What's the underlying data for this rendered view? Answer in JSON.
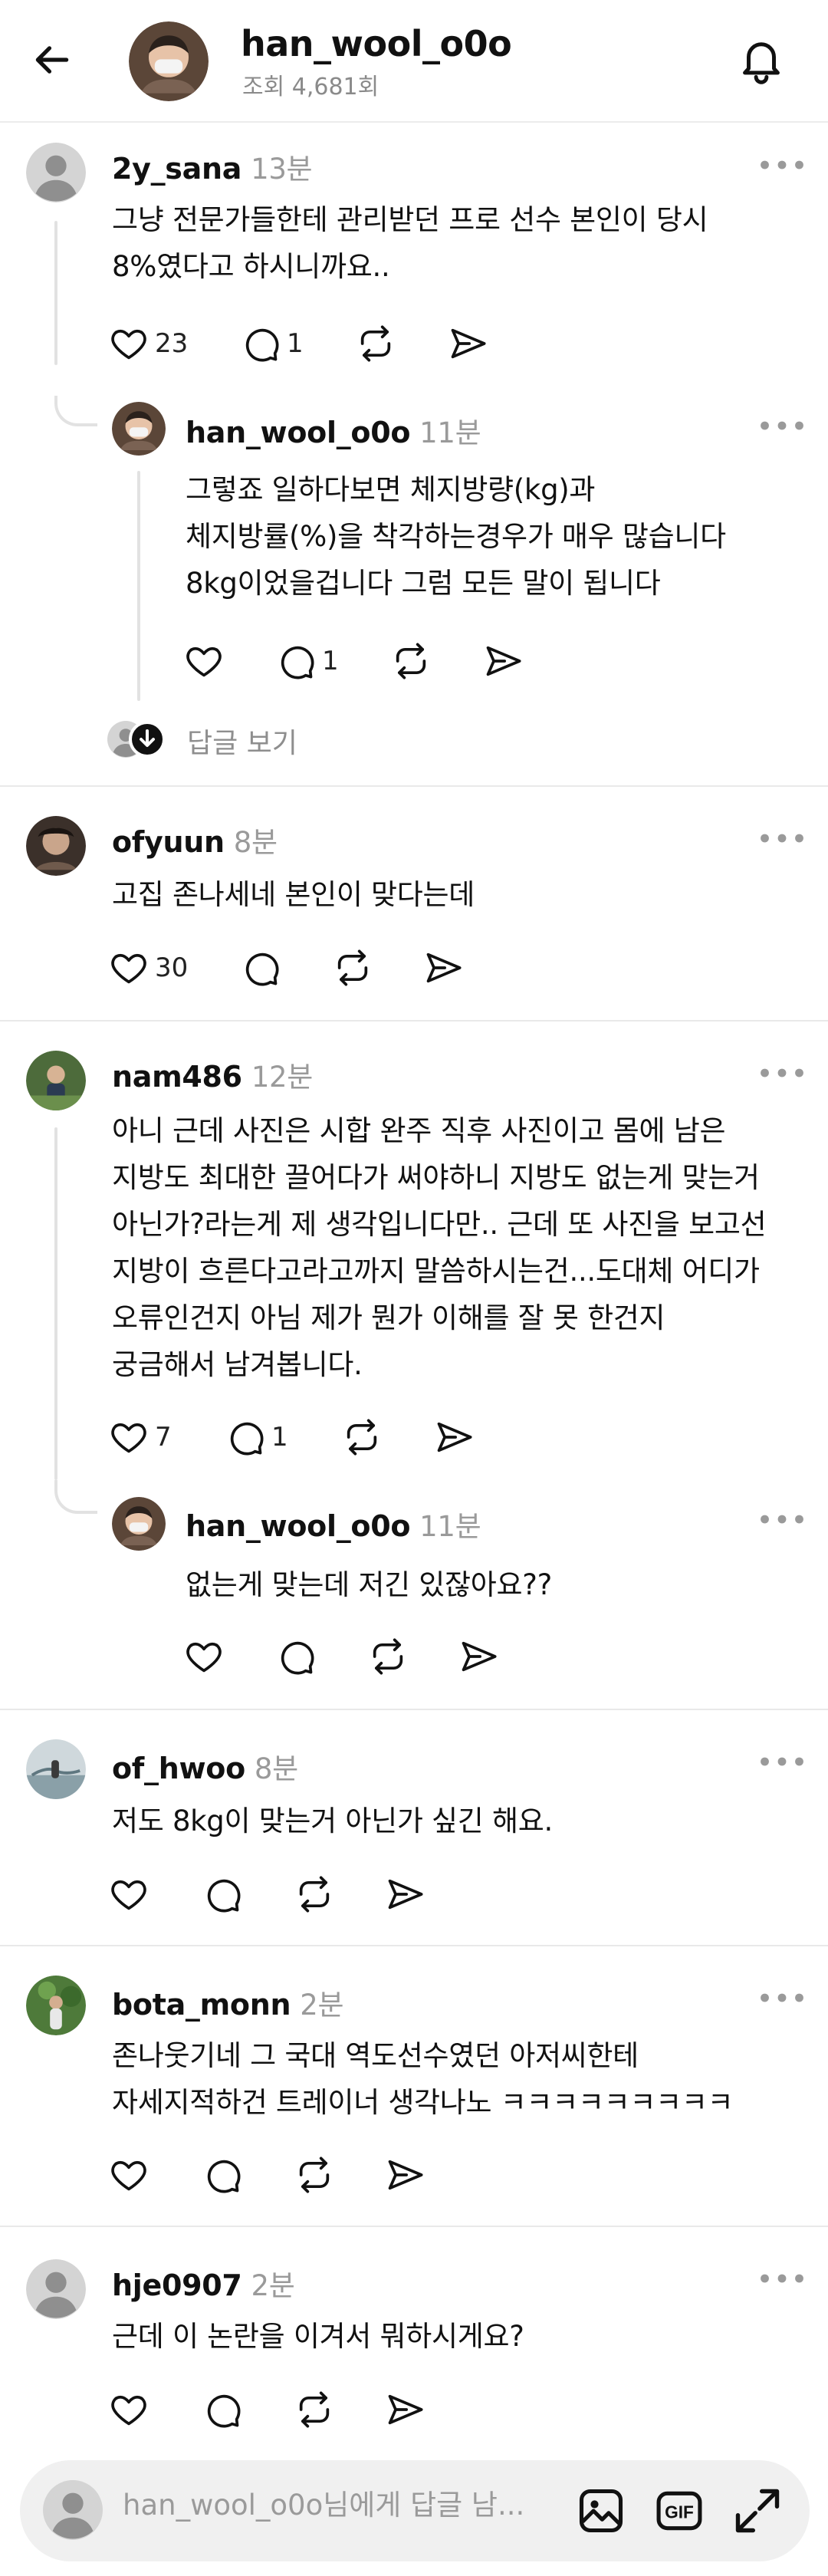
{
  "header": {
    "username": "han_wool_o0o",
    "views": "조회 4,681회"
  },
  "comments": [
    {
      "username": "2y_sana",
      "time": "13분",
      "text": "그냥 전문가들한테 관리받던 프로 선수 본인이 당시\n8%였다고 하시니까요..",
      "likes": "23",
      "replies": "1",
      "reply": {
        "username": "han_wool_o0o",
        "time": "11분",
        "text": "그렇죠 일하다보면 체지방량(kg)과\n체지방률(%)을 착각하는경우가 매우 많습니다\n8kg이었을겁니다 그럼 모든 말이 됩니다",
        "likes": "",
        "replies": "1"
      },
      "view_replies": "답글 보기"
    },
    {
      "username": "ofyuun",
      "time": "8분",
      "text": "고집 존나세네 본인이 맞다는데",
      "likes": "30",
      "replies": ""
    },
    {
      "username": "nam486",
      "time": "12분",
      "text": "아니 근데 사진은 시합 완주 직후 사진이고 몸에 남은\n지방도 최대한 끌어다가 써야하니 지방도 없는게 맞는거\n아닌가?라는게 제 생각입니다만.. 근데 또 사진을 보고선\n지방이 흐른다고라고까지 말씀하시는건...도대체 어디가\n오류인건지 아님 제가 뭔가 이해를 잘 못 한건지\n궁금해서 남겨봅니다.",
      "likes": "7",
      "replies": "1",
      "reply": {
        "username": "han_wool_o0o",
        "time": "11분",
        "text": "없는게 맞는데 저긴 있잖아요??",
        "likes": "",
        "replies": ""
      }
    },
    {
      "username": "of_hwoo",
      "time": "8분",
      "text": "저도 8kg이 맞는거 아닌가 싶긴 해요.",
      "likes": "",
      "replies": ""
    },
    {
      "username": "bota_monn",
      "time": "2분",
      "text": "존나웃기네 그 국대 역도선수였던 아저씨한테\n자세지적하건 트레이너 생각나노 ㅋㅋㅋㅋㅋㅋㅋㅋㅋ",
      "likes": "",
      "replies": ""
    },
    {
      "username": "hje0907",
      "time": "2분",
      "text": "근데 이 논란을 이겨서 뭐하시게요?",
      "likes": "",
      "replies": ""
    }
  ],
  "reply_bar": {
    "placeholder": "han_wool_o0o님에게 답글 남..."
  },
  "icons": [
    "back-arrow-icon",
    "bell-icon",
    "heart-icon",
    "comment-icon",
    "repost-icon",
    "share-icon",
    "more-icon",
    "image-icon",
    "gif-icon",
    "expand-icon",
    "default-avatar-icon",
    "arrow-down-badge-icon"
  ],
  "colors": {
    "text": "#111111",
    "muted": "#9a9a9a",
    "divider": "#e9e9e9",
    "bar": "#f0f0f0"
  }
}
